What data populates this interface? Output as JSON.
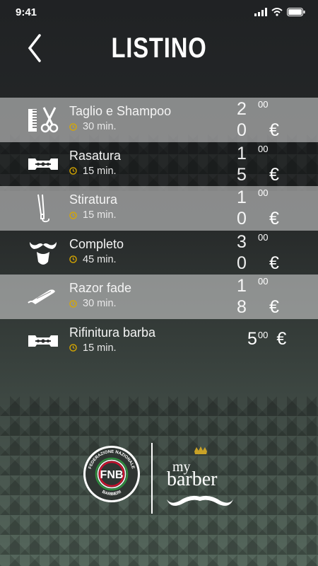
{
  "status": {
    "time": "9:41"
  },
  "header": {
    "title": "LISTINO"
  },
  "services": [
    {
      "name": "Taglio e Shampoo",
      "duration": "30 min.",
      "price_digit1": "2",
      "price_digit2": "0",
      "cents": "00",
      "currency": "€",
      "icon": "scissors-comb-icon",
      "highlighted": true
    },
    {
      "name": "Rasatura",
      "duration": "15 min.",
      "price_digit1": "1",
      "price_digit2": "5",
      "cents": "00",
      "currency": "€",
      "icon": "razor-blade-icon",
      "highlighted": false
    },
    {
      "name": "Stiratura",
      "duration": "15 min.",
      "price_digit1": "1",
      "price_digit2": "0",
      "cents": "00",
      "currency": "€",
      "icon": "hair-straightener-icon",
      "highlighted": true
    },
    {
      "name": "Completo",
      "duration": "45 min.",
      "price_digit1": "3",
      "price_digit2": "0",
      "cents": "00",
      "currency": "€",
      "icon": "mustache-beard-icon",
      "highlighted": false
    },
    {
      "name": "Razor fade",
      "duration": "30 min.",
      "price_digit1": "1",
      "price_digit2": "8",
      "cents": "00",
      "currency": "€",
      "icon": "straight-razor-icon",
      "highlighted": true
    },
    {
      "name": "Rifinitura barba",
      "duration": "15 min.",
      "price": "5",
      "cents": "00",
      "currency": "€",
      "icon": "razor-blade-icon",
      "highlighted": false
    }
  ],
  "footer": {
    "fnb": {
      "initials": "FNB",
      "ring_top": "FEDERAZIONE NAZIONALE",
      "ring_bottom": "BARBIERI"
    },
    "brand": {
      "line1": "my",
      "line2": "barber"
    }
  },
  "colors": {
    "clock": "#d8a800",
    "highlight": "#c9c9c9"
  }
}
